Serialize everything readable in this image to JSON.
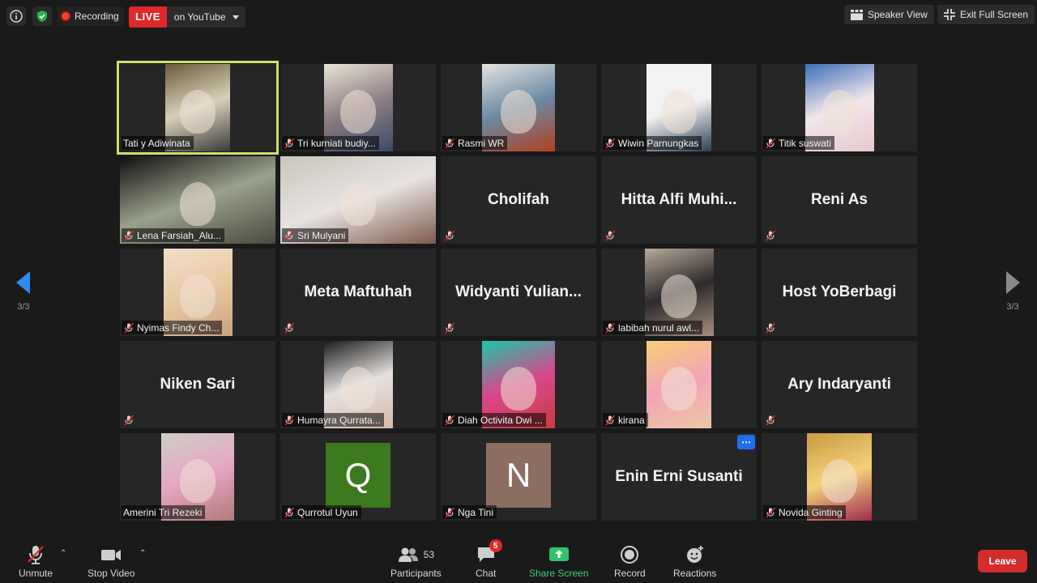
{
  "topbar": {
    "recording_label": "Recording",
    "live_badge": "LIVE",
    "live_target": "on YouTube",
    "speaker_view": "Speaker View",
    "exit_fullscreen": "Exit Full Screen"
  },
  "pagination": {
    "left": "3/3",
    "right": "3/3"
  },
  "participants": [
    {
      "name": "Tati y Adiwinata",
      "type": "video",
      "active": true,
      "muted": false,
      "colors": [
        "#6b5a3b",
        "#d8d0b8",
        "#3a3a3a"
      ]
    },
    {
      "name": "Tri kurniati  budiy...",
      "type": "video",
      "muted": true,
      "colors": [
        "#e9e4d6",
        "#8f7d84",
        "#3a4b6a"
      ]
    },
    {
      "name": "Rasmi WR",
      "type": "video",
      "muted": true,
      "colors": [
        "#e6e3df",
        "#6a8aa5",
        "#b2401f"
      ]
    },
    {
      "name": "Wiwin Parnungkas",
      "type": "video",
      "muted": true,
      "colors": [
        "#f2f2f2",
        "#f2f2f2",
        "#2c3f5a"
      ]
    },
    {
      "name": "Titik suswati",
      "type": "video",
      "muted": true,
      "colors": [
        "#3b6fb7",
        "#f1e6ea",
        "#e7c9cd"
      ]
    },
    {
      "name": "Lena Farsiah_Alu...",
      "type": "video",
      "muted": true,
      "colors": [
        "#0f0f0f",
        "#9aa18a",
        "#4a4a3e"
      ]
    },
    {
      "name": "Sri Mulyani",
      "type": "video",
      "muted": true,
      "colors": [
        "#c9c7bd",
        "#e7e2e1",
        "#7e5a4a"
      ]
    },
    {
      "name": "Cholifah",
      "type": "name",
      "muted": true
    },
    {
      "name": "Hitta Alfi Muhi...",
      "type": "name",
      "muted": true
    },
    {
      "name": "Reni As",
      "type": "name",
      "muted": true
    },
    {
      "name": "Nyimas Findy Ch...",
      "type": "video",
      "muted": true,
      "colors": [
        "#f1dfc8",
        "#e8c9a2",
        "#caa27e"
      ]
    },
    {
      "name": "Meta Maftuhah",
      "type": "name",
      "muted": true
    },
    {
      "name": "Widyanti  Yulian...",
      "type": "name",
      "muted": true
    },
    {
      "name": "labibah nurul awl...",
      "type": "video",
      "muted": true,
      "colors": [
        "#b8a99a",
        "#2d2a2c",
        "#a98f80"
      ]
    },
    {
      "name": "Host YoBerbagi",
      "type": "name",
      "muted": true
    },
    {
      "name": "Niken Sari",
      "type": "name",
      "muted": true
    },
    {
      "name": "Humayra Qurrata...",
      "type": "video",
      "muted": true,
      "colors": [
        "#1b1b1b",
        "#e4e0de",
        "#d8b9a8"
      ]
    },
    {
      "name": "Diah Octivita Dwi ...",
      "type": "video",
      "muted": true,
      "colors": [
        "#19c8a8",
        "#d9478e",
        "#c93c3c"
      ]
    },
    {
      "name": "kirana",
      "type": "video",
      "muted": true,
      "colors": [
        "#f5cf7a",
        "#f3a4b5",
        "#eac9a4"
      ]
    },
    {
      "name": "Ary Indaryanti",
      "type": "name",
      "muted": true
    },
    {
      "name": "Amerini Tri Rezeki",
      "type": "video",
      "muted": false,
      "colors": [
        "#cfcfc8",
        "#e6a6c4",
        "#b07b78"
      ]
    },
    {
      "name": "Qurrotul Uyun",
      "type": "letter",
      "letter": "Q",
      "muted": true,
      "colors": [
        "#3b7a1f"
      ]
    },
    {
      "name": "Nga Tini",
      "type": "letter",
      "letter": "N",
      "muted": true,
      "colors": [
        "#8d6e63"
      ]
    },
    {
      "name": "Enin Erni Susanti",
      "type": "name",
      "muted": false,
      "more": true
    },
    {
      "name": "Novida Ginting",
      "type": "video",
      "muted": true,
      "colors": [
        "#c79a3f",
        "#f3d27a",
        "#a32a4d"
      ]
    }
  ],
  "toolbar": {
    "unmute": "Unmute",
    "stop_video": "Stop Video",
    "participants": "Participants",
    "participants_count": "53",
    "chat": "Chat",
    "chat_badge": "5",
    "share_screen": "Share Screen",
    "record": "Record",
    "reactions": "Reactions",
    "leave": "Leave"
  },
  "colors": {
    "active_border": "#c8e26a",
    "live_red": "#e02828",
    "share_green": "#3ad07a",
    "leave_red": "#d42b2b"
  }
}
